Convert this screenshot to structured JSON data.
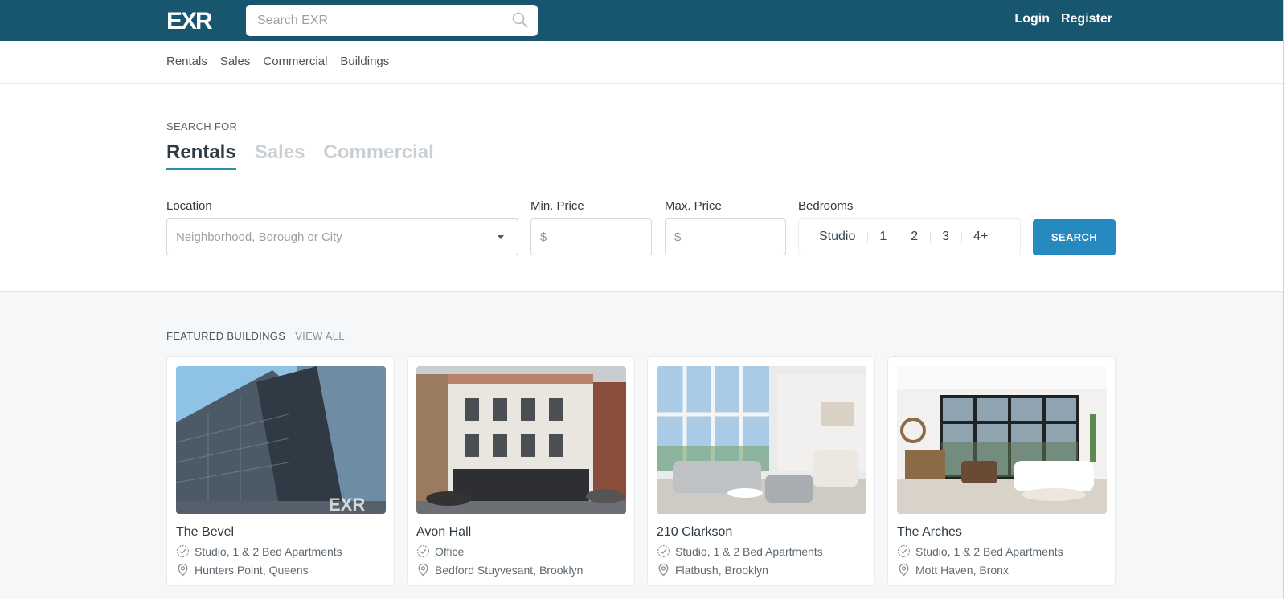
{
  "header": {
    "logo_text": "EXR",
    "search_placeholder": "Search EXR",
    "login": "Login",
    "register": "Register"
  },
  "nav": [
    "Rentals",
    "Sales",
    "Commercial",
    "Buildings"
  ],
  "search": {
    "search_for": "SEARCH FOR",
    "tabs": [
      "Rentals",
      "Sales",
      "Commercial"
    ],
    "active_tab": "Rentals",
    "location_label": "Location",
    "location_placeholder": "Neighborhood, Borough or City",
    "min_label": "Min. Price",
    "max_label": "Max. Price",
    "currency": "$",
    "bedrooms_label": "Bedrooms",
    "bedrooms": [
      "Studio",
      "1",
      "2",
      "3",
      "4+"
    ],
    "button": "SEARCH"
  },
  "featured": {
    "title": "FEATURED BUILDINGS",
    "view_all": "VIEW ALL",
    "cards": [
      {
        "name": "The Bevel",
        "type": "Studio, 1 & 2 Bed Apartments",
        "location": "Hunters Point, Queens"
      },
      {
        "name": "Avon Hall",
        "type": "Office",
        "location": "Bedford Stuyvesant, Brooklyn"
      },
      {
        "name": "210 Clarkson",
        "type": "Studio, 1 & 2 Bed Apartments",
        "location": "Flatbush, Brooklyn"
      },
      {
        "name": "The Arches",
        "type": "Studio, 1 & 2 Bed Apartments",
        "location": "Mott Haven, Bronx"
      }
    ]
  },
  "colors": {
    "header_bg": "#18556e",
    "accent": "#2a8fa8",
    "button": "#2689bf"
  }
}
